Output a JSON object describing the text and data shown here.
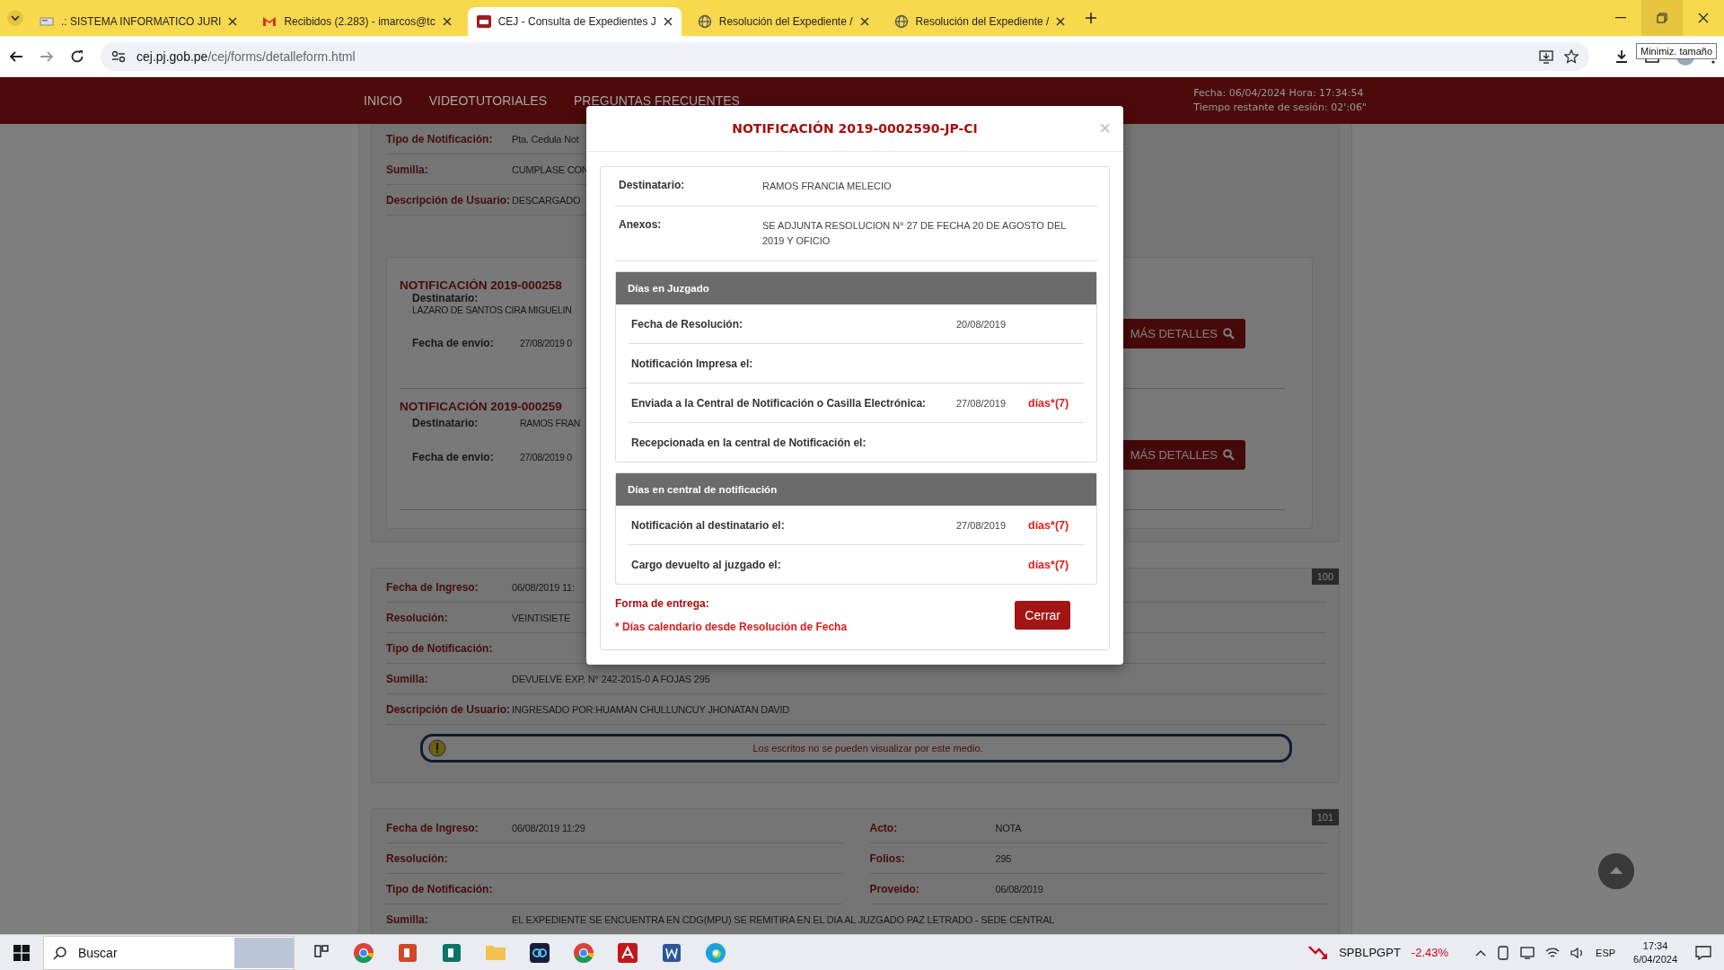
{
  "browser": {
    "tabs": [
      {
        "title": ".: SISTEMA INFORMATICO JURI",
        "selected": false
      },
      {
        "title": "Recibidos (2.283) - imarcos@tc",
        "selected": false
      },
      {
        "title": "CEJ - Consulta de Expedientes J",
        "selected": true
      },
      {
        "title": "Resolución del Expediente /",
        "selected": false
      },
      {
        "title": "Resolución del Expediente /",
        "selected": false
      }
    ],
    "url": {
      "domain": "cej.pj.gob.pe",
      "path": "/cej/forms/detalleform.html"
    },
    "tooltip": "Minimiz. tamaño"
  },
  "nav": {
    "items": [
      "INICIO",
      "VIDEOTUTORIALES",
      "PREGUNTAS FRECUENTES"
    ],
    "clock": [
      "Fecha: 06/04/2024 Hora: 17:34:54",
      "Tiempo restante de sesión: 02':06\""
    ]
  },
  "top_card": {
    "rows": [
      {
        "label": "Tipo de Notificación:",
        "value": "Pta. Cedula Not"
      },
      {
        "label": "Sumilla:",
        "value": "CUMPLASE CON"
      },
      {
        "label": "Descripción de Usuario:",
        "value": "DESCARGADO"
      }
    ],
    "notifications": [
      {
        "title": "NOTIFICACIÓN 2019-000258",
        "kind": "stacked",
        "recipient_label": "Destinatario:",
        "recipient": "LAZARO DE SANTOS CIRA MIGUELIN",
        "date_label": "Fecha de envio:",
        "date": "27/08/2019 0",
        "button": "MÁS DETALLES"
      },
      {
        "title": "NOTIFICACIÓN 2019-000259",
        "kind": "inline",
        "recipient_label": "Destinatario:",
        "recipient": "RAMOS FRAN",
        "date_label": "Fecha de envio:",
        "date": "27/08/2019 0",
        "button": "MÁS DETALLES"
      }
    ]
  },
  "records": [
    {
      "number": "100",
      "left": [
        {
          "label": "Fecha de Ingreso:",
          "value": "06/08/2019 11:"
        },
        {
          "label": "Resolución:",
          "value": "VEINTISIETE"
        },
        {
          "label": "Tipo de Notificación:"
        },
        {
          "label": "Sumilla:",
          "value": "DEVUELVE EXP. N° 242-2015-0 A FOJAS 295"
        },
        {
          "label": "Descripción de Usuario:",
          "value": "INGRESADO POR:HUAMAN CHULLUNCUY JHONATAN DAVID"
        }
      ],
      "warning": "Los escritos no se pueden visualizar por este medio."
    },
    {
      "number": "101",
      "left": [
        {
          "label": "Fecha de Ingreso:",
          "value": "06/08/2019 11:29"
        },
        {
          "label": "Resolución:"
        },
        {
          "label": "Tipo de Notificación:"
        }
      ],
      "right": [
        {
          "label": "Acto:",
          "value": "NOTA"
        },
        {
          "label": "Folios:",
          "value": "295"
        },
        {
          "label": "Proveido:",
          "value": "06/08/2019"
        }
      ],
      "wide": {
        "label": "Sumilla:",
        "value": "EL EXPEDIENTE SE ENCUENTRA EN CDG(MPU) SE REMITIRA EN EL DIA AL JUZGADO PAZ LETRADO - SEDE CENTRAL"
      }
    }
  ],
  "modal": {
    "title": "NOTIFICACIÓN 2019-0002590-JP-CI",
    "close": "×",
    "fields": [
      {
        "label": "Destinatario:",
        "value": "RAMOS FRANCIA MELECIO"
      },
      {
        "label": "Anexos:",
        "value": "SE ADJUNTA RESOLUCION N° 27 DE FECHA 20 DE AGOSTO DEL 2019 Y OFICIO"
      }
    ],
    "sections": [
      {
        "title": "Días en Juzgado",
        "rows": [
          {
            "label": "Fecha de Resolución:",
            "date": "20/08/2019"
          },
          {
            "label": "Notificación Impresa el:"
          },
          {
            "label": "Enviada a la Central de Notificación o Casilla Electrónica:",
            "date": "27/08/2019",
            "days": "días*(7)"
          },
          {
            "label": "Recepcionada en la central de Notificación el:"
          }
        ]
      },
      {
        "title": "Días en central de notificación",
        "rows": [
          {
            "label": "Notificación al destinatario el:",
            "date": "27/08/2019",
            "days": "días*(7)"
          },
          {
            "label": "Cargo devuelto al juzgado el:",
            "days": "días*(7)"
          }
        ]
      }
    ],
    "delivery_label": "Forma de entrega:",
    "footnote": "* Días calendario desde Resolución de Fecha",
    "close_button": "Cerrar"
  },
  "taskbar": {
    "search": "Buscar",
    "stock": {
      "name": "SPBLPGPT",
      "change": "-2.43%"
    },
    "language": "ESP",
    "time": "17:34",
    "date": "6/04/2024"
  }
}
